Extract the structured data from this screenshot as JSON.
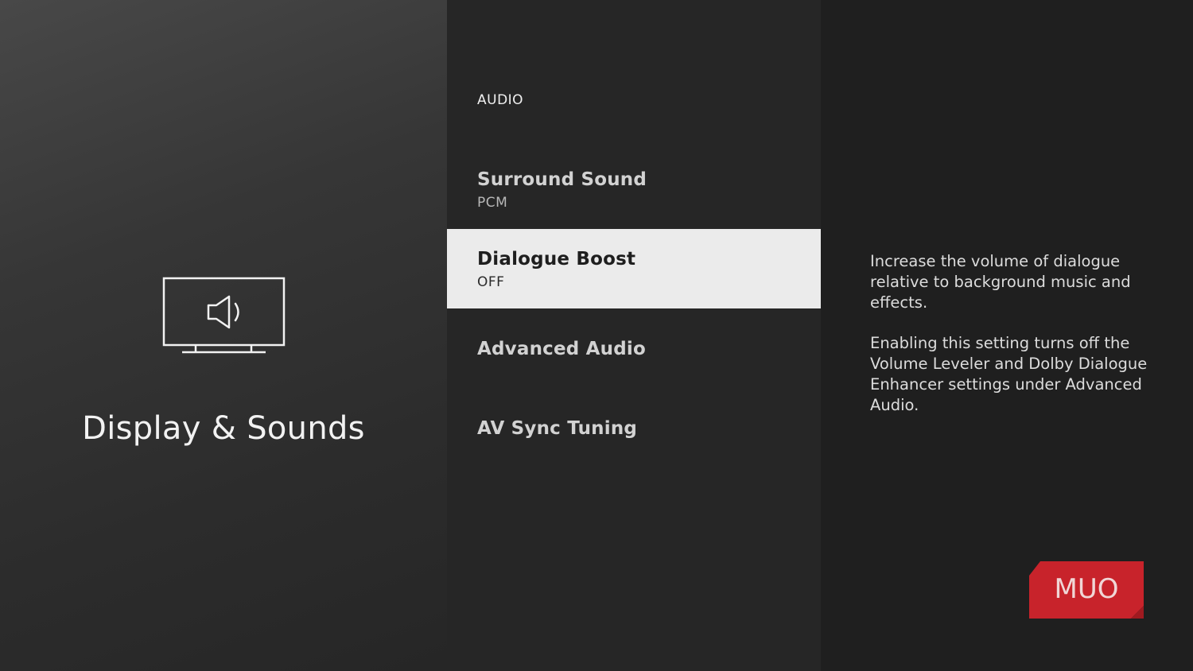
{
  "left": {
    "icon": "tv-speaker-icon",
    "title": "Display & Sounds"
  },
  "menu": {
    "header": "AUDIO",
    "items": [
      {
        "label": "Surround Sound",
        "value": "PCM",
        "selected": false
      },
      {
        "label": "Dialogue Boost",
        "value": "OFF",
        "selected": true
      },
      {
        "label": "Advanced Audio",
        "value": "",
        "selected": false
      },
      {
        "label": "AV Sync Tuning",
        "value": "",
        "selected": false
      }
    ]
  },
  "description": {
    "paragraph1": "Increase the volume of dialogue relative to background music and effects.",
    "paragraph2": "Enabling this setting turns off the Volume Leveler and Dolby Dialogue Enhancer settings under Advanced Audio."
  },
  "watermark": {
    "text": "MUO",
    "color": "#c8232b"
  },
  "colors": {
    "selected_bg": "#ebebeb",
    "selected_text": "#1e1e1e",
    "text_primary": "#f2f2f2"
  }
}
